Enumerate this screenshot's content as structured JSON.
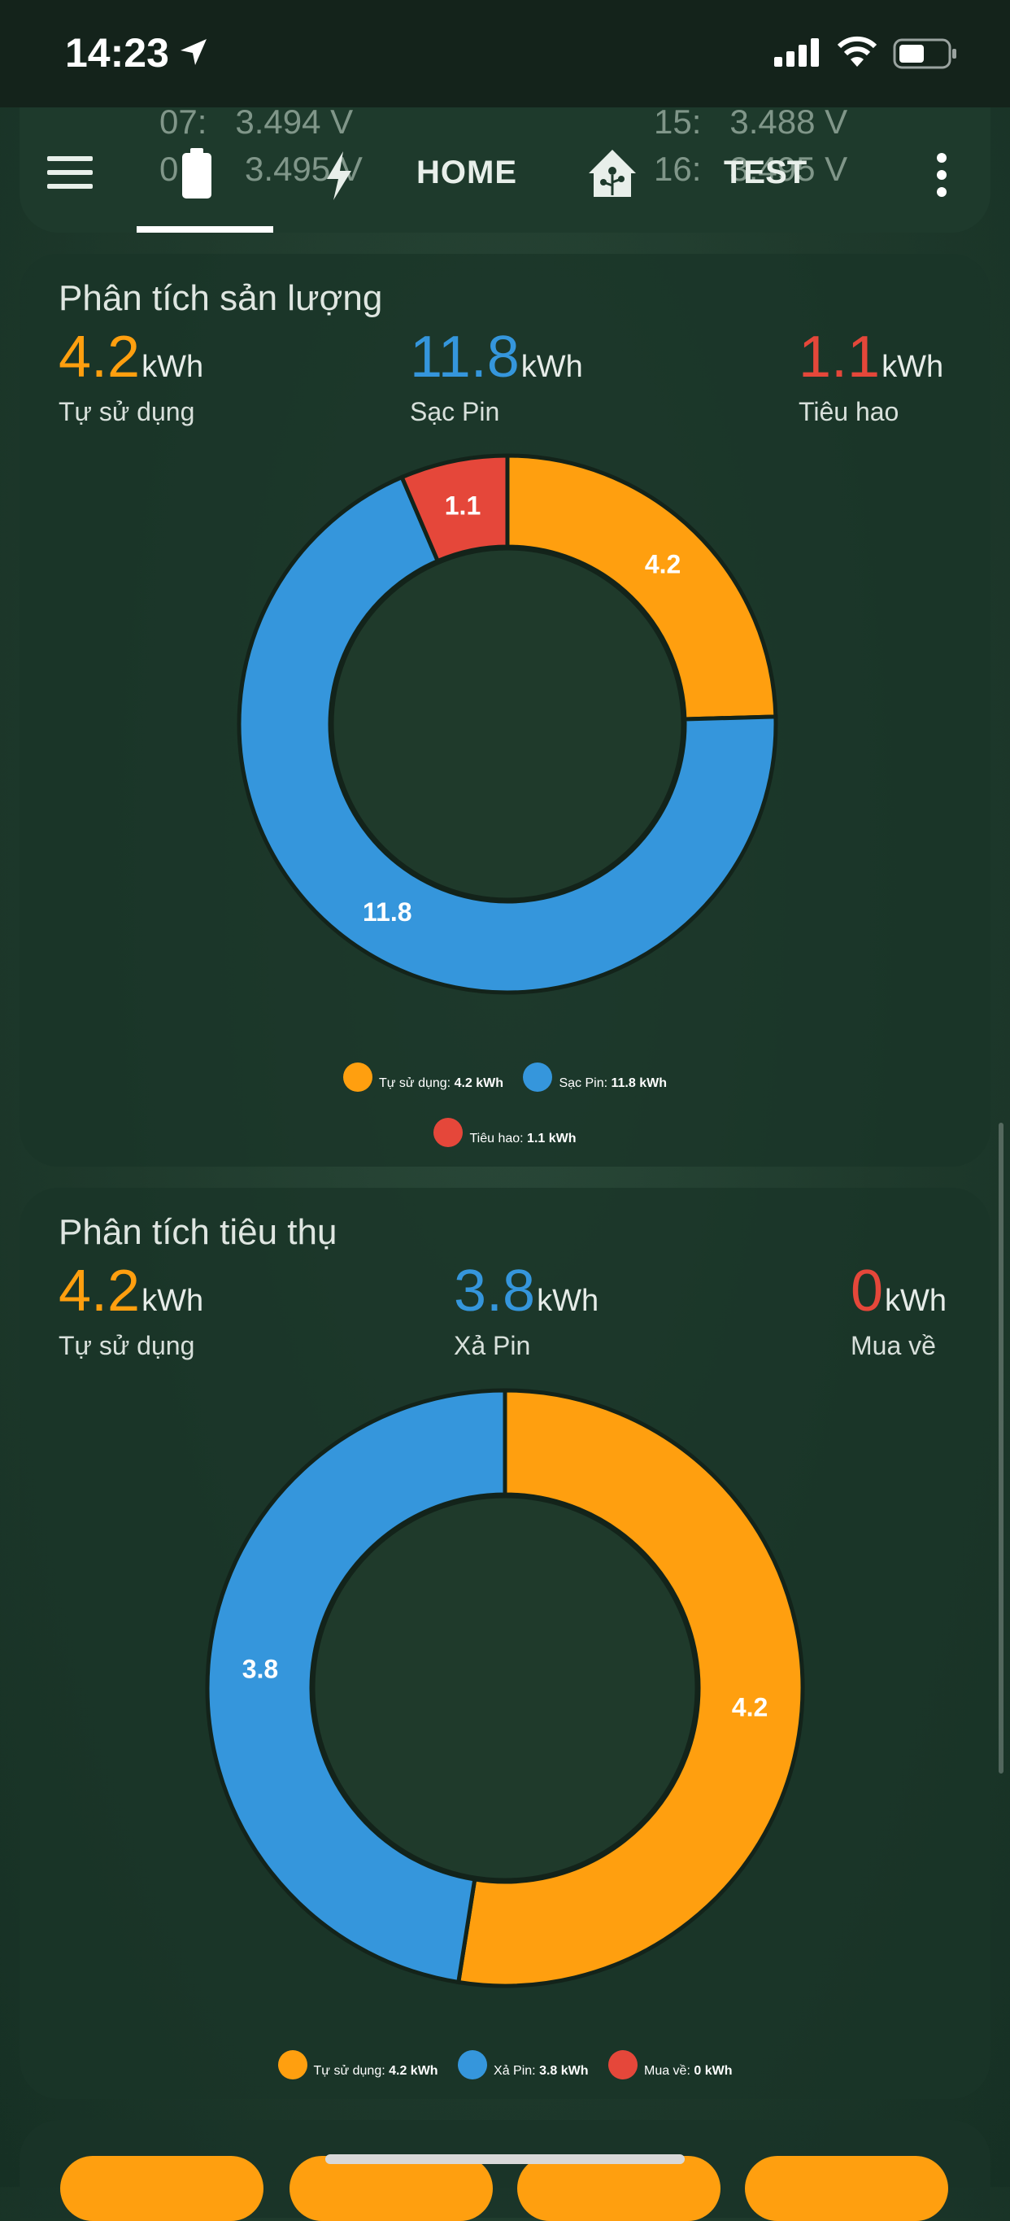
{
  "status_bar": {
    "time": "14:23",
    "icons": [
      "location-arrow-icon",
      "signal-icon",
      "wifi-icon",
      "battery-icon"
    ]
  },
  "header": {
    "background_voltages": [
      {
        "label": "07:",
        "value": "3.494 V"
      },
      {
        "label": "0",
        "value": "3.495 V"
      },
      {
        "label": "15:",
        "value": "3.488 V"
      },
      {
        "label": "16:",
        "value": "3.495 V"
      }
    ],
    "tabs": [
      {
        "icon": "battery-icon",
        "active": true
      },
      {
        "icon": "lightning-bolt-icon"
      },
      {
        "label": "HOME"
      },
      {
        "icon": "home-assistant-icon"
      },
      {
        "label": "TEST"
      }
    ]
  },
  "card1": {
    "title": "Phân tích sản lượng",
    "stats": [
      {
        "value": "4.2",
        "unit": "kWh",
        "label": "Tự sử dụng",
        "color": "#ff9f0f"
      },
      {
        "value": "11.8",
        "unit": "kWh",
        "label": "Sạc Pin",
        "color": "#3596dc"
      },
      {
        "value": "1.1",
        "unit": "kWh",
        "label": "Tiêu hao",
        "color": "#e5473a"
      }
    ],
    "legend_values": [
      "4.2 kWh",
      "11.8 kWh",
      "1.1 kWh"
    ]
  },
  "card2": {
    "title": "Phân tích tiêu thụ",
    "stats": [
      {
        "value": "4.2",
        "unit": "kWh",
        "label": "Tự sử dụng",
        "color": "#ff9f0f"
      },
      {
        "value": "3.8",
        "unit": "kWh",
        "label": "Xả Pin",
        "color": "#3596dc"
      },
      {
        "value": "0",
        "unit": "kWh",
        "label": "Mua về",
        "color": "#e5473a"
      }
    ],
    "legend_values": [
      "4.2 kWh",
      "3.8 kWh",
      "0 kWh"
    ]
  },
  "chart_data": [
    {
      "type": "pie",
      "title": "Phân tích sản lượng",
      "categories": [
        "Tự sử dụng",
        "Sạc Pin",
        "Tiêu hao"
      ],
      "values": [
        4.2,
        11.8,
        1.1
      ],
      "colors": [
        "#ff9f0f",
        "#3596dc",
        "#e5473a"
      ],
      "data_labels": [
        "4.2",
        "11.8",
        "1.1"
      ],
      "legend": "bottom"
    },
    {
      "type": "pie",
      "title": "Phân tích tiêu thụ",
      "categories": [
        "Tự sử dụng",
        "Xả Pin",
        "Mua về"
      ],
      "values": [
        4.2,
        3.8,
        0
      ],
      "colors": [
        "#ff9f0f",
        "#3596dc",
        "#e5473a"
      ],
      "data_labels": [
        "4.2",
        "3.8",
        ""
      ],
      "legend": "bottom"
    }
  ]
}
